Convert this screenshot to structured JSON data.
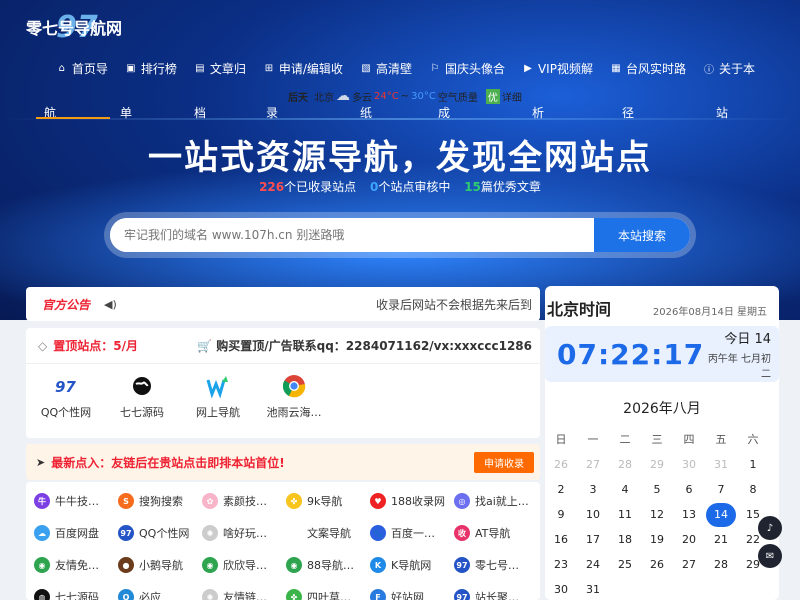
{
  "logo": {
    "text": "零七号导航网",
    "number": "97"
  },
  "nav": [
    {
      "label": "首页导",
      "icon": "home-icon",
      "glyph": "⌂"
    },
    {
      "label": "排行榜",
      "icon": "user-icon",
      "glyph": "▣"
    },
    {
      "label": "文章归",
      "icon": "image-icon",
      "glyph": "▤"
    },
    {
      "label": "申请/编辑收",
      "icon": "plus-square-icon",
      "glyph": "⊞"
    },
    {
      "label": "高清壁",
      "icon": "picture-icon",
      "glyph": "▧"
    },
    {
      "label": "国庆头像合",
      "icon": "flag-icon",
      "glyph": "⚐"
    },
    {
      "label": "VIP视频解",
      "icon": "video-icon",
      "glyph": "▶"
    },
    {
      "label": "台风实时路",
      "icon": "building-icon",
      "glyph": "▦"
    },
    {
      "label": "关于本",
      "icon": "info-icon",
      "glyph": "ⓘ"
    }
  ],
  "weather": {
    "prefix": "后天",
    "city": "北京",
    "condition": "多云",
    "high": "24°C",
    "sep": "~",
    "low": "30°C",
    "aq_label": "空气质量",
    "aq_value": "优",
    "detail": "详细"
  },
  "tagline_chars": [
    "航",
    "单",
    "档",
    "录",
    "纸",
    "成",
    "析",
    "径",
    "站"
  ],
  "slogan": "一站式资源导航，发现全网站点",
  "stats": {
    "collected": "226",
    "collected_label": "个已收录站点",
    "pending": "0",
    "pending_label": "个站点审核中",
    "articles": "15",
    "articles_label": "篇优秀文章"
  },
  "search": {
    "placeholder": "牢记我们的域名 www.107h.cn 别迷路哦",
    "button": "本站搜索"
  },
  "notice": {
    "badge": "官方公告",
    "text": "收录后网站不会根据先来后到"
  },
  "pinned": {
    "title": "置顶站点：5/月",
    "buy": "购买置顶/广告联系qq：2284071162/vx:xxxccc1286",
    "sites": [
      {
        "label": "QQ个性网",
        "icon": "qq-gexing-icon"
      },
      {
        "label": "七七源码",
        "icon": "globe-icon"
      },
      {
        "label": "网上导航",
        "icon": "w-arrow-icon"
      },
      {
        "label": "池雨云海…",
        "icon": "chrome-icon"
      }
    ]
  },
  "promo": {
    "text": "最新点入：友链后在贵站点击即排本站首位!",
    "button": "申请收录"
  },
  "links": [
    {
      "label": "牛牛技…",
      "color": "#7b3fe4",
      "glyph": "牛"
    },
    {
      "label": "搜狗搜索",
      "color": "#f56c1c",
      "glyph": "S"
    },
    {
      "label": "素颜技…",
      "color": "#f8b4c8",
      "glyph": "✿"
    },
    {
      "label": "9k导航",
      "color": "#f7c51e",
      "glyph": "✤"
    },
    {
      "label": "188收录网",
      "color": "#e22",
      "glyph": "♥"
    },
    {
      "label": "找ai就上…",
      "color": "#6b6ff0",
      "glyph": "◎"
    },
    {
      "label": "百度网盘",
      "color": "#3aa0f0",
      "glyph": "☁"
    },
    {
      "label": "QQ个性网",
      "color": "#2554c7",
      "glyph": "97"
    },
    {
      "label": "啥好玩…",
      "color": "#ccc",
      "glyph": "✺"
    },
    {
      "label": "文案导航",
      "color": "#fff",
      "glyph": ""
    },
    {
      "label": "百度一…",
      "color": "#2a5fe0",
      "glyph": "🐾"
    },
    {
      "label": "AT导航",
      "color": "#e8336a",
      "glyph": "收"
    },
    {
      "label": "友情免…",
      "color": "#2ea44f",
      "glyph": "◉"
    },
    {
      "label": "小鹅导航",
      "color": "#6b3b1c",
      "glyph": "●"
    },
    {
      "label": "欣欣导…",
      "color": "#2ea44f",
      "glyph": "◉"
    },
    {
      "label": "88导航…",
      "color": "#2ea44f",
      "glyph": "◉"
    },
    {
      "label": "K导航网",
      "color": "#1f8ae8",
      "glyph": "K"
    },
    {
      "label": "零七号…",
      "color": "#2554c7",
      "glyph": "97"
    },
    {
      "label": "七七源码",
      "color": "#111",
      "glyph": "◍"
    },
    {
      "label": "必应",
      "color": "#2189d6",
      "glyph": "Q"
    },
    {
      "label": "友情链…",
      "color": "#ccc",
      "glyph": "✺"
    },
    {
      "label": "四叶草…",
      "color": "#3bb54a",
      "glyph": "✤"
    },
    {
      "label": "好站网",
      "color": "#2a7be0",
      "glyph": "F"
    },
    {
      "label": "站长聚…",
      "color": "#2554c7",
      "glyph": "97"
    }
  ],
  "clock": {
    "title": "北京时间",
    "date": "2026年08月14日 星期五",
    "time": "07:22:17",
    "lunar_day": "今日 14",
    "lunar_date": "丙午年 七月初二"
  },
  "calendar": {
    "month": "2026年八月",
    "weekdays": [
      "日",
      "一",
      "二",
      "三",
      "四",
      "五",
      "六"
    ],
    "days": [
      {
        "d": "26",
        "o": true
      },
      {
        "d": "27",
        "o": true
      },
      {
        "d": "28",
        "o": true
      },
      {
        "d": "29",
        "o": true
      },
      {
        "d": "30",
        "o": true
      },
      {
        "d": "31",
        "o": true
      },
      {
        "d": "1"
      },
      {
        "d": "2"
      },
      {
        "d": "3"
      },
      {
        "d": "4"
      },
      {
        "d": "5"
      },
      {
        "d": "6"
      },
      {
        "d": "7"
      },
      {
        "d": "8"
      },
      {
        "d": "9"
      },
      {
        "d": "10"
      },
      {
        "d": "11"
      },
      {
        "d": "12"
      },
      {
        "d": "13"
      },
      {
        "d": "14",
        "t": true
      },
      {
        "d": "15"
      },
      {
        "d": "16"
      },
      {
        "d": "17"
      },
      {
        "d": "18"
      },
      {
        "d": "19"
      },
      {
        "d": "20"
      },
      {
        "d": "21"
      },
      {
        "d": "22"
      },
      {
        "d": "23"
      },
      {
        "d": "24"
      },
      {
        "d": "25"
      },
      {
        "d": "26"
      },
      {
        "d": "27"
      },
      {
        "d": "28"
      },
      {
        "d": "29"
      },
      {
        "d": "30"
      },
      {
        "d": "31"
      }
    ]
  },
  "fab": [
    {
      "icon": "bell-icon",
      "glyph": "♪"
    },
    {
      "icon": "mail-icon",
      "glyph": "✉"
    }
  ]
}
